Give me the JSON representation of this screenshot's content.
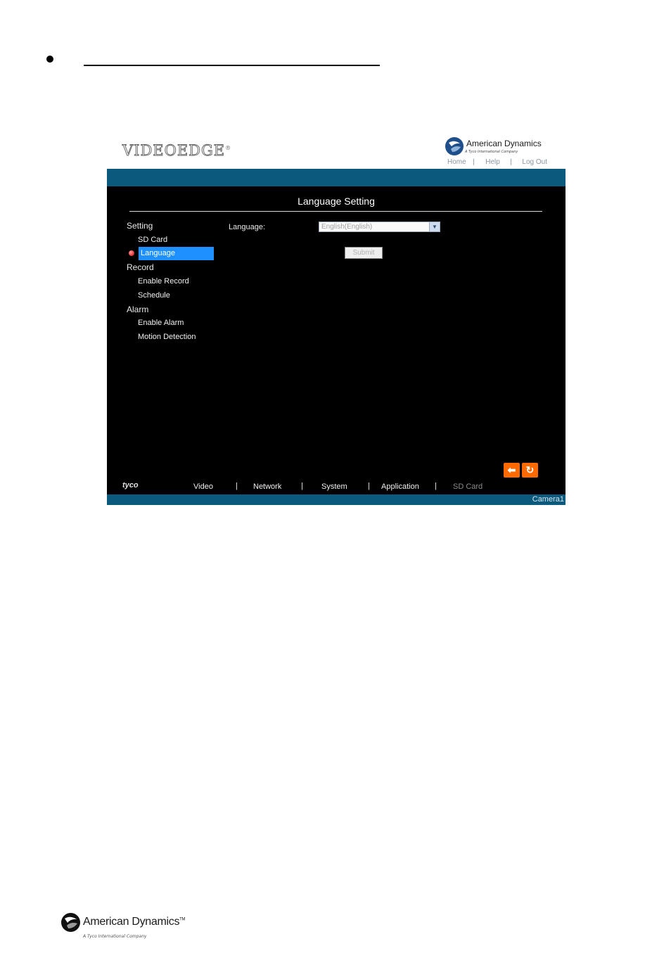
{
  "header": {
    "product_logo": "VIDEOEDGE",
    "brand_name": "American Dynamics",
    "brand_tagline": "A Tyco International Company",
    "links": [
      "Home",
      "Help",
      "Log Out"
    ]
  },
  "panel": {
    "title": "Language Setting",
    "menu": {
      "setting_head": "Setting",
      "sd_card": "SD Card",
      "language": "Language",
      "record_head": "Record",
      "enable_record": "Enable Record",
      "schedule": "Schedule",
      "alarm_head": "Alarm",
      "enable_alarm": "Enable Alarm",
      "motion_detection": "Motion Detection"
    },
    "form": {
      "language_label": "Language:",
      "language_value": "English(English)",
      "submit_label": "Submit"
    }
  },
  "footer_nav": {
    "tyco": "tyco",
    "items": [
      "Video",
      "Network",
      "System",
      "Application",
      "SD Card"
    ],
    "separator": "|",
    "camera_label": "Camera1"
  },
  "page_footer": {
    "brand_name": "American Dynamics",
    "tm": "TM",
    "tagline": "A Tyco International Company"
  },
  "colors": {
    "accent_blue": "#0b5a7d",
    "selected_item": "#1e90ff",
    "control_orange": "#ff6a00"
  }
}
